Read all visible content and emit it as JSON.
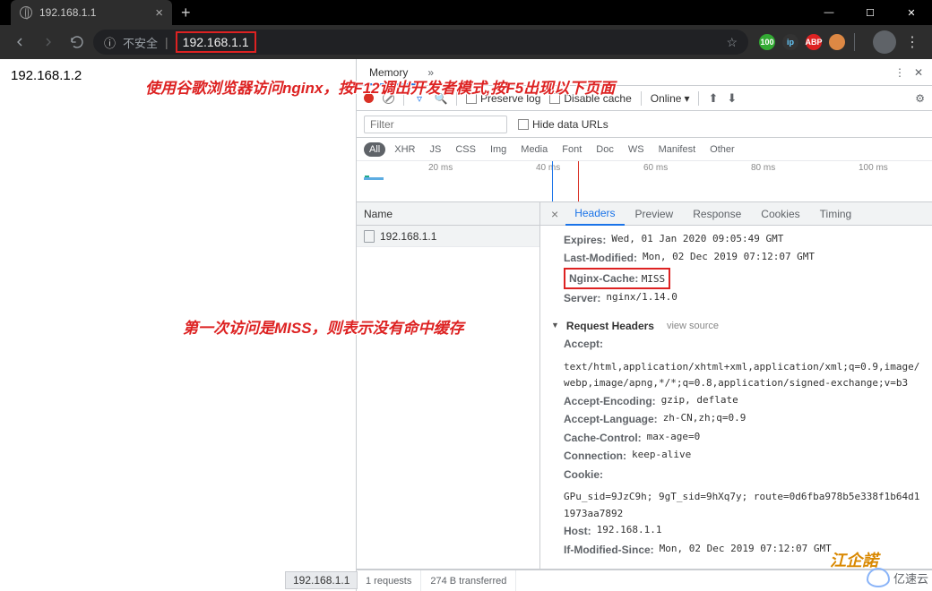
{
  "window": {
    "tab_title": "192.168.1.1",
    "new_tab": "+"
  },
  "address": {
    "insecure_label": "不安全",
    "url": "192.168.1.1"
  },
  "page": {
    "body_text": "192.168.1.2"
  },
  "annotations": {
    "line1": "使用谷歌浏览器访问nginx，按F12调出开发者模式,按F5出现以下页面",
    "line2": "第一次访问是MISS，则表示没有命中缓存"
  },
  "devtools": {
    "tabs": {
      "memory": "Memory",
      "more": "»"
    },
    "toolbar": {
      "preserve": "Preserve log",
      "disable_cache": "Disable cache",
      "online": "Online"
    },
    "filter": {
      "placeholder": "Filter",
      "hide_data": "Hide data URLs"
    },
    "types": [
      "All",
      "XHR",
      "JS",
      "CSS",
      "Img",
      "Media",
      "Font",
      "Doc",
      "WS",
      "Manifest",
      "Other"
    ],
    "timeline": {
      "ticks": [
        "20 ms",
        "40 ms",
        "60 ms",
        "80 ms",
        "100 ms"
      ]
    },
    "name_header": "Name",
    "rows": [
      {
        "name": "192.168.1.1"
      }
    ],
    "detail_tabs": [
      "Headers",
      "Preview",
      "Response",
      "Cookies",
      "Timing"
    ],
    "response_headers": {
      "Expires": "Wed, 01 Jan 2020 09:05:49 GMT",
      "Last-Modified": "Mon, 02 Dec 2019 07:12:07 GMT",
      "Nginx-Cache": "MISS",
      "Server": "nginx/1.14.0"
    },
    "request_headers_title": "Request Headers",
    "view_source": "view source",
    "request_headers": {
      "Accept": "text/html,application/xhtml+xml,application/xml;q=0.9,image/webp,image/apng,*/*;q=0.8,application/signed-exchange;v=b3",
      "Accept-Encoding": "gzip, deflate",
      "Accept-Language": "zh-CN,zh;q=0.9",
      "Cache-Control": "max-age=0",
      "Connection": "keep-alive",
      "Cookie": "GPu_sid=9JzC9h; 9gT_sid=9hXq7y; route=0d6fba978b5e338f1b64d11973aa7892",
      "Host": "192.168.1.1",
      "If-Modified-Since": "Mon, 02 Dec 2019 07:12:07 GMT"
    },
    "status": {
      "requests": "1 requests",
      "transferred": "274 B transferred"
    },
    "hover_url": "192.168.1.1"
  },
  "watermark": {
    "text": "亿速云",
    "art": "江企諾"
  }
}
